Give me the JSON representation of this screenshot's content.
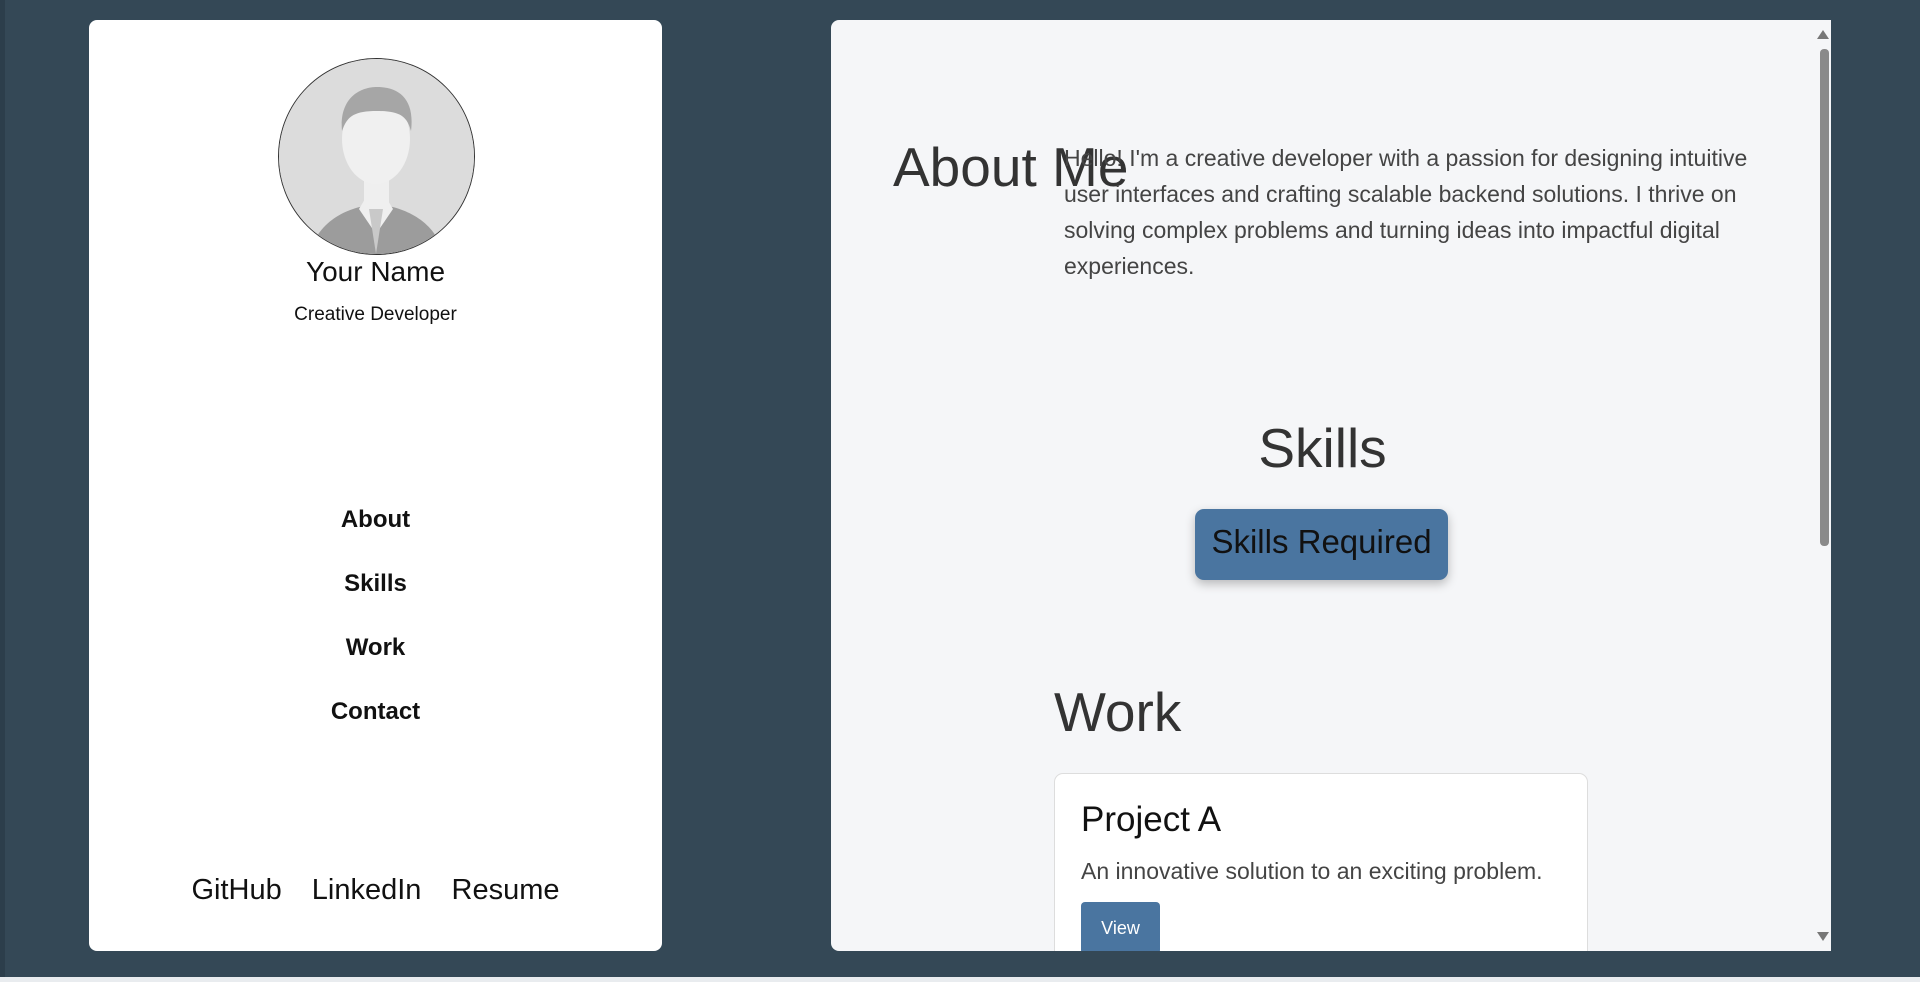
{
  "sidebar": {
    "name": "Your Name",
    "role": "Creative Developer",
    "nav": [
      "About",
      "Skills",
      "Work",
      "Contact"
    ],
    "socials": [
      "GitHub",
      "LinkedIn",
      "Resume"
    ]
  },
  "about": {
    "title": "About Me",
    "text": "Hello! I'm a creative developer with a passion for designing intuitive user interfaces and crafting scalable backend solutions. I thrive on solving complex problems and turning ideas into impactful digital experiences."
  },
  "skills": {
    "title": "Skills",
    "badge": "Skills Required"
  },
  "work": {
    "title": "Work",
    "projects": [
      {
        "title": "Project A",
        "description": "An innovative solution to an exciting problem.",
        "button": "View"
      }
    ]
  },
  "colors": {
    "background": "#344856",
    "accent": "#4a75a0",
    "panel": "#f5f6f8"
  }
}
